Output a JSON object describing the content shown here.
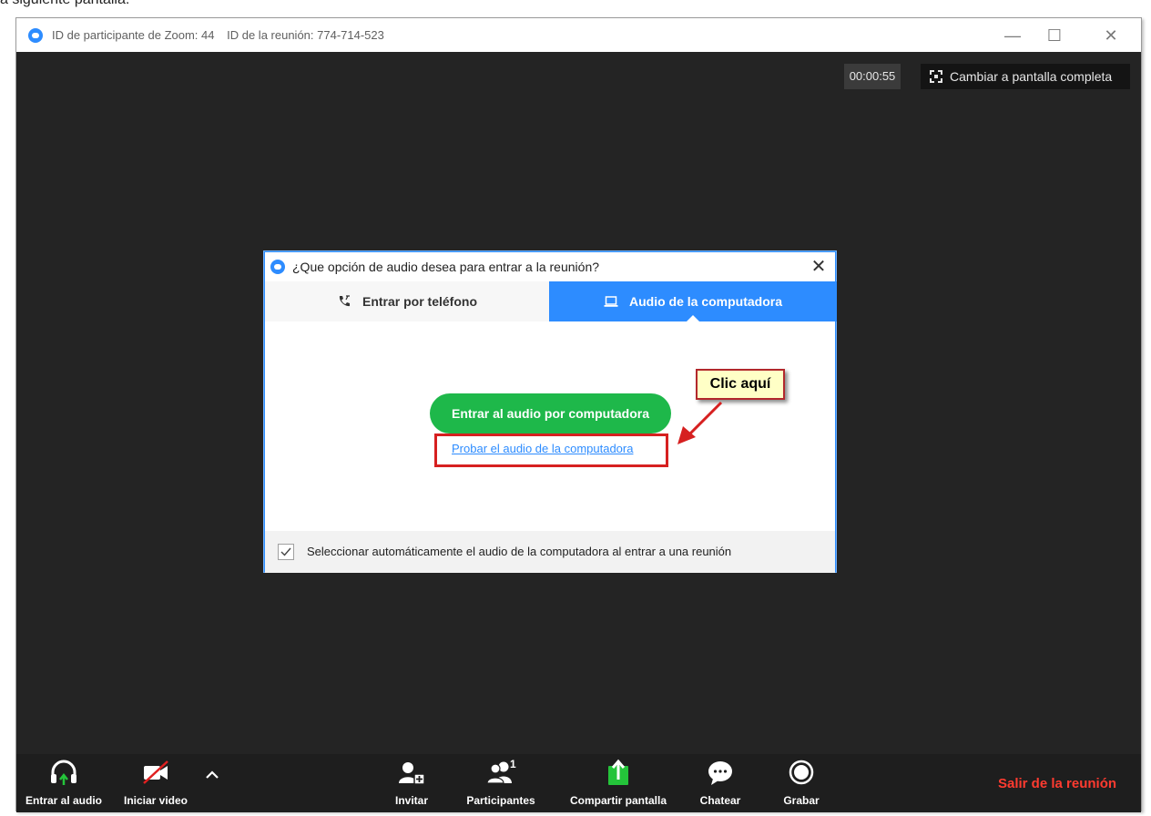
{
  "page_caption": "a siguiente pantalla:",
  "window": {
    "participant_id": "ID de participante de Zoom: 44",
    "meeting_id": "ID de la reunión: 774-714-523",
    "controls": {
      "minimize": "—",
      "maximize": "☐",
      "close": "✕"
    }
  },
  "top_bar": {
    "timer": "00:00:55",
    "fullscreen_label": "Cambiar a pantalla completa"
  },
  "dialog": {
    "title": "¿Que opción de audio desea para entrar a la reunión?",
    "close": "✕",
    "tabs": [
      {
        "label": "Entrar por teléfono",
        "icon": "phone-icon",
        "active": false
      },
      {
        "label": "Audio de la computadora",
        "icon": "laptop-icon",
        "active": true
      }
    ],
    "join_button": "Entrar al audio por computadora",
    "test_link": "Probar el audio de la computadora",
    "auto_select_checked": true,
    "auto_select_label": "Seleccionar automáticamente el audio de la computadora al entrar a una reunión"
  },
  "annotation": {
    "callout": "Clic aquí"
  },
  "toolbar": {
    "join_audio": "Entrar al audio",
    "start_video": "Iniciar video",
    "invite": "Invitar",
    "participants": "Participantes",
    "participants_count": "1",
    "share_screen": "Compartir pantalla",
    "chat": "Chatear",
    "record": "Grabar",
    "leave": "Salir de la reunión"
  },
  "colors": {
    "zoom_blue": "#2d8cff",
    "join_green": "#1eb84a",
    "share_green": "#24c43a",
    "leave_red": "#ff3b30",
    "stage_bg": "#242424",
    "annotation_red": "#d62020",
    "callout_bg": "#ffffc6"
  }
}
